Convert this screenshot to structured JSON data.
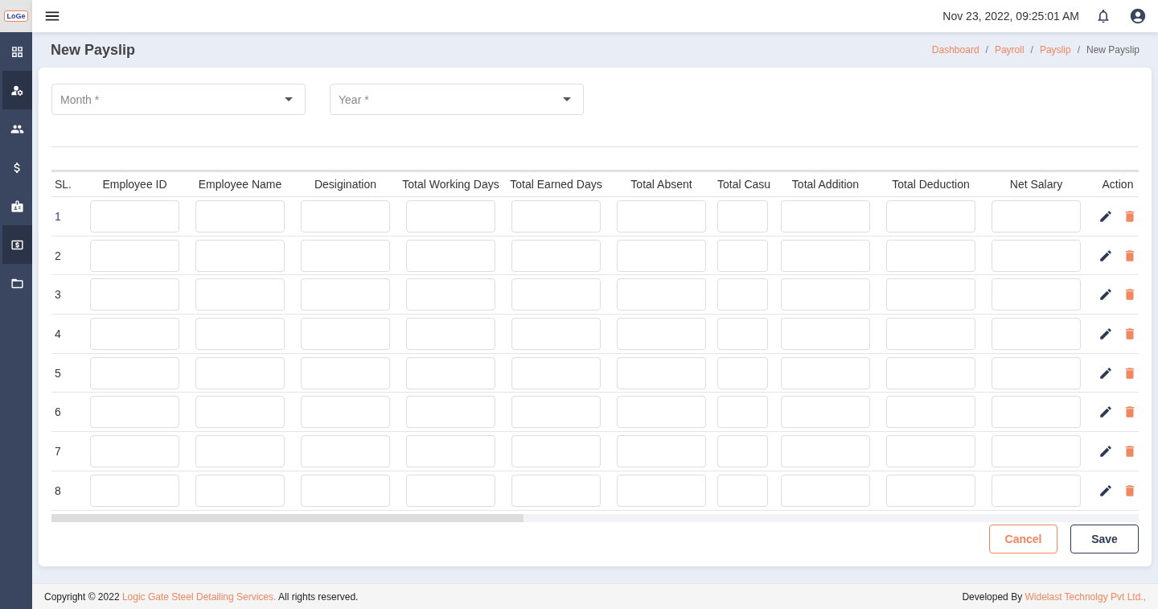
{
  "logo": {
    "text": "LoGe"
  },
  "sidebar": {
    "items": [
      {
        "selected": false
      },
      {
        "selected": true
      },
      {
        "selected": false
      },
      {
        "selected": false
      },
      {
        "selected": false
      },
      {
        "selected": true
      },
      {
        "selected": false
      }
    ]
  },
  "topbar": {
    "datetime": "Nov 23, 2022, 09:25:01 AM"
  },
  "page": {
    "title": "New Payslip",
    "breadcrumb": [
      {
        "label": "Dashboard",
        "kind": "link"
      },
      {
        "label": "/",
        "kind": "separator"
      },
      {
        "label": "Payroll",
        "kind": "link"
      },
      {
        "label": "/",
        "kind": "separator"
      },
      {
        "label": "Payslip",
        "kind": "link"
      },
      {
        "label": "/",
        "kind": "separator"
      },
      {
        "label": "New Payslip",
        "kind": "current"
      }
    ]
  },
  "filters": [
    {
      "placeholder": "Month *"
    },
    {
      "placeholder": "Year *"
    }
  ],
  "table": {
    "columns": [
      {
        "label": "SL.",
        "kind": "sl"
      },
      {
        "label": "Employee ID",
        "kind": "input"
      },
      {
        "label": "Employee Name",
        "kind": "input"
      },
      {
        "label": "Desigination",
        "kind": "input"
      },
      {
        "label": "Total Working Days",
        "kind": "input"
      },
      {
        "label": "Total Earned Days",
        "kind": "input"
      },
      {
        "label": "Total Absent",
        "kind": "input"
      },
      {
        "label": "Total Casu",
        "kind": "clipped"
      },
      {
        "label": "Total Addition",
        "kind": "input"
      },
      {
        "label": "Total Deduction",
        "kind": "input"
      },
      {
        "label": "Net Salary",
        "kind": "input"
      },
      {
        "label": "Action",
        "kind": "action"
      }
    ],
    "rows": [
      {
        "sl": "1"
      },
      {
        "sl": "2"
      },
      {
        "sl": "3"
      },
      {
        "sl": "4"
      },
      {
        "sl": "5"
      },
      {
        "sl": "6"
      },
      {
        "sl": "7"
      },
      {
        "sl": "8"
      }
    ]
  },
  "buttons": [
    {
      "label": "Cancel",
      "kind": "cancel"
    },
    {
      "label": "Save",
      "kind": "save"
    }
  ],
  "footer": {
    "left": [
      {
        "text": "Copyright © 2022 ",
        "kind": "text"
      },
      {
        "text": "Logic Gate Steel Detailing Services.",
        "kind": "link"
      },
      {
        "text": " All rights reserved.",
        "kind": "text"
      }
    ],
    "right": [
      {
        "text": "Developed By ",
        "kind": "text"
      },
      {
        "text": "Widelast Technolgy Pvt Ltd.,",
        "kind": "link"
      }
    ]
  }
}
